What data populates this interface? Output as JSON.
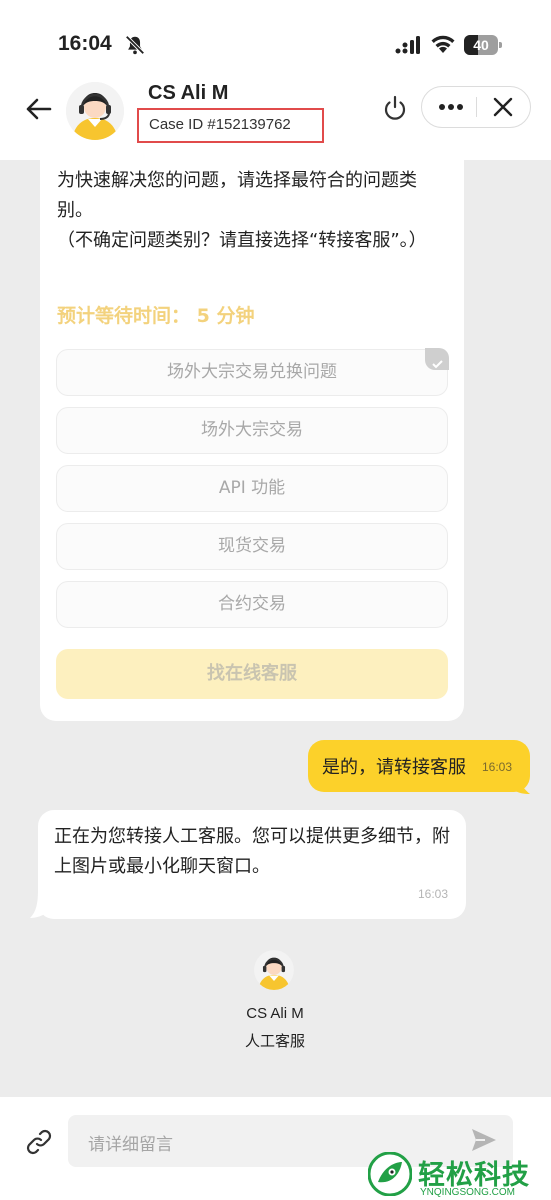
{
  "status_bar": {
    "time": "16:04",
    "battery": "40",
    "battery_level": 0.4
  },
  "header": {
    "agent_name": "CS Ali M",
    "case_id": "Case ID #152139762"
  },
  "messages": {
    "bot_main": {
      "lines": [
        "为快速解决您的问题，请选择最符合的问题类别。",
        "（不确定问题类别？请直接选择“转接客服”。）"
      ],
      "wait_label": "预计等待时间： 5 分钟",
      "options": [
        "场外大宗交易兑换问题",
        "场外大宗交易",
        "API 功能",
        "现货交易",
        "合约交易"
      ],
      "primary_button": "找在线客服"
    },
    "user_reply": {
      "text": "是的，请转接客服",
      "time": "16:03"
    },
    "bot_transfer": {
      "text": "正在为您转接人工客服。您可以提供更多细节，附上图片或最小化聊天窗口。",
      "time": "16:03"
    },
    "agent_card": {
      "name": "CS Ali M",
      "role": "人工客服"
    }
  },
  "input": {
    "placeholder": "请详细留言"
  },
  "watermark": {
    "text": "轻松科技",
    "sub": "YNQINGSONG.COM"
  },
  "colors": {
    "accent": "#fcd12a",
    "wait": "#f3d27d",
    "highlight_box": "#e14b4b",
    "brand_green": "#22a046"
  }
}
